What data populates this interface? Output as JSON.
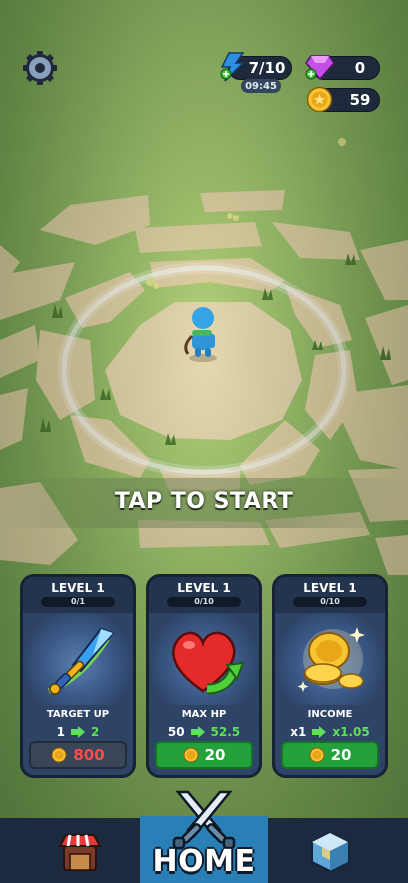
{
  "hud": {
    "energy": "7/10",
    "energy_timer": "09:45",
    "gems": "0",
    "coins": "59"
  },
  "prompt": "TAP TO START",
  "upgrades": [
    {
      "level": "LEVEL 1",
      "progress": "0/1",
      "progress_fraction": 0,
      "name": "TARGET UP",
      "from": "1",
      "to": "2",
      "cost": "800",
      "affordable": false,
      "icon": "sword-icon"
    },
    {
      "level": "LEVEL 1",
      "progress": "0/10",
      "progress_fraction": 0,
      "name": "MAX HP",
      "from": "50",
      "to": "52.5",
      "cost": "20",
      "affordable": true,
      "icon": "heart-icon"
    },
    {
      "level": "LEVEL 1",
      "progress": "0/10",
      "progress_fraction": 0,
      "name": "INCOME",
      "from": "x1",
      "to": "x1.05",
      "cost": "20",
      "affordable": true,
      "icon": "gold-coins-icon"
    }
  ],
  "nav": {
    "home_label": "HOME",
    "left_icon": "shop-icon",
    "right_icon": "cube-icon"
  },
  "colors": {
    "grass": "#9cc26c",
    "stone": "#e3d3a6",
    "card": "#2e4466",
    "buy_green": "#23a23c",
    "locked_price": "#ff4b4b",
    "nav_active": "#2b7fb7"
  }
}
